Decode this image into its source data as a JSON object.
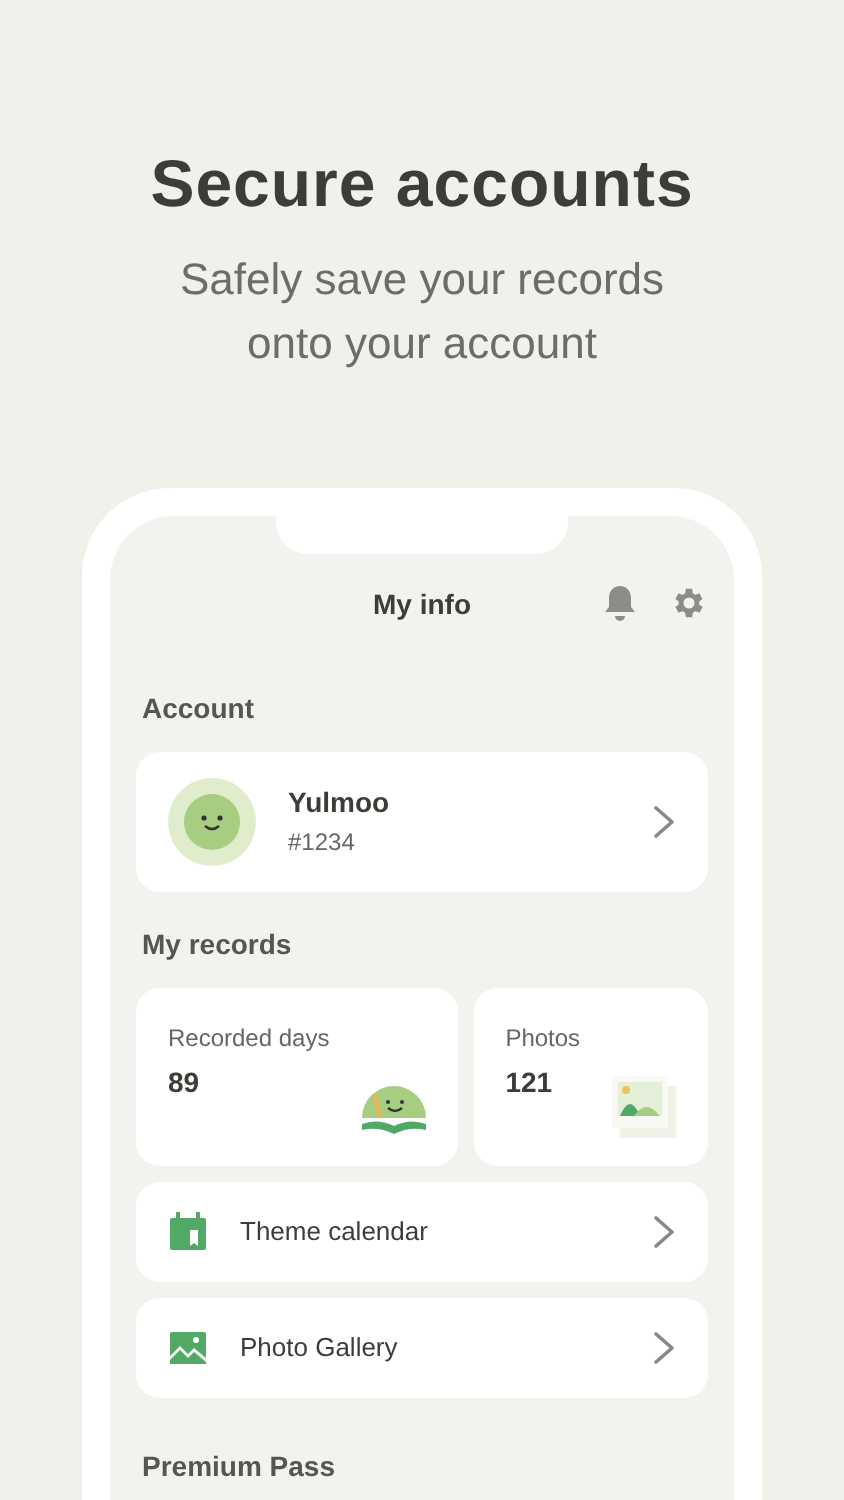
{
  "headline": "Secure accounts",
  "subtitle": "Safely save your records onto your account",
  "screen": {
    "title": "My info",
    "account": {
      "label": "Account",
      "name": "Yulmoo",
      "tag": "#1234"
    },
    "records": {
      "label": "My records",
      "stats": [
        {
          "kind": "days",
          "label": "Recorded days",
          "value": "89"
        },
        {
          "kind": "photos",
          "label": "Photos",
          "value": "121"
        }
      ],
      "links": [
        {
          "kind": "calendar",
          "label": "Theme calendar"
        },
        {
          "kind": "gallery",
          "label": "Photo Gallery"
        }
      ]
    },
    "premium": {
      "label": "Premium Pass"
    }
  }
}
